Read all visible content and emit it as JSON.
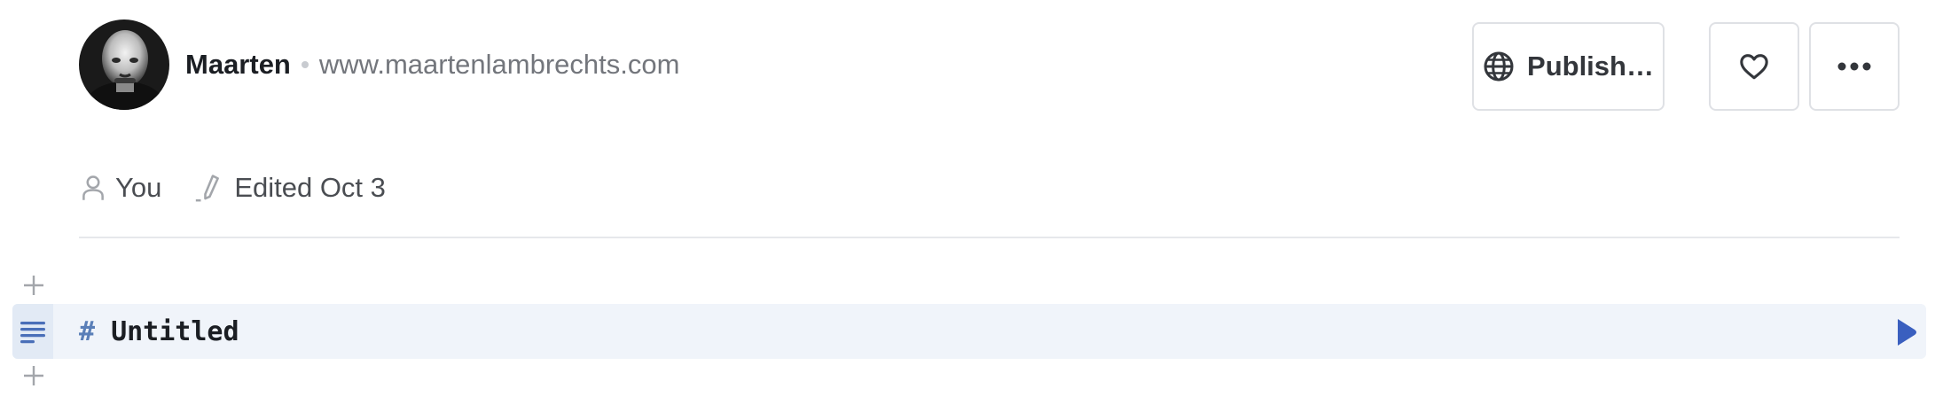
{
  "header": {
    "author_name": "Maarten",
    "author_url": "www.maartenlambrechts.com"
  },
  "toolbar": {
    "publish_label": "Publish…",
    "like_icon": "heart-icon",
    "more_icon": "more-horizontal-icon"
  },
  "meta": {
    "owner_label": "You",
    "edited_label": "Edited Oct 3"
  },
  "cell": {
    "hash": "#",
    "title": "Untitled"
  },
  "colors": {
    "accent": "#3a5fbf",
    "cell_background": "#f0f4fa",
    "cell_gutter": "#e2eaf5",
    "hash_color": "#5a7fb8"
  }
}
